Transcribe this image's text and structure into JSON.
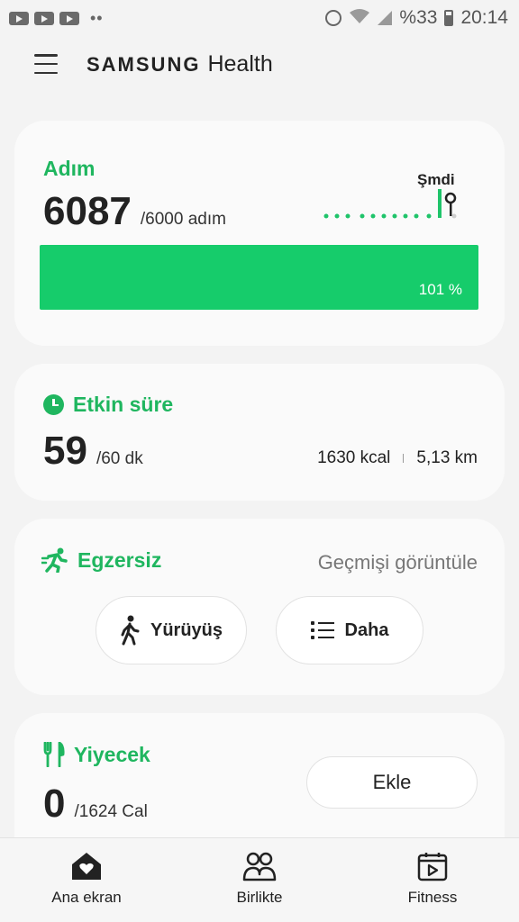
{
  "status_bar": {
    "battery": "%33",
    "time": "20:14"
  },
  "header": {
    "brand_samsung": "SAMSUNG",
    "brand_health": "Health"
  },
  "steps": {
    "title": "Adım",
    "value": "6087",
    "goal": "/6000 adım",
    "progress_fraction": 1.0,
    "progress_label": "101 %",
    "now_label": "Şmdi"
  },
  "active_time": {
    "title": "Etkin süre",
    "value": "59",
    "goal": "/60 dk",
    "calories": "1630 kcal",
    "distance": "5,13 km"
  },
  "exercise": {
    "title": "Egzersiz",
    "history_link": "Geçmişi görüntüle",
    "walk_label": "Yürüyüş",
    "more_label": "Daha"
  },
  "food": {
    "title": "Yiyecek",
    "value": "0",
    "goal": "/1624 Cal",
    "add_label": "Ekle"
  },
  "bottom_nav": {
    "home": "Ana ekran",
    "together": "Birlikte",
    "fitness": "Fitness"
  },
  "colors": {
    "accent": "#1fb65f",
    "progress": "#16cc6b"
  }
}
